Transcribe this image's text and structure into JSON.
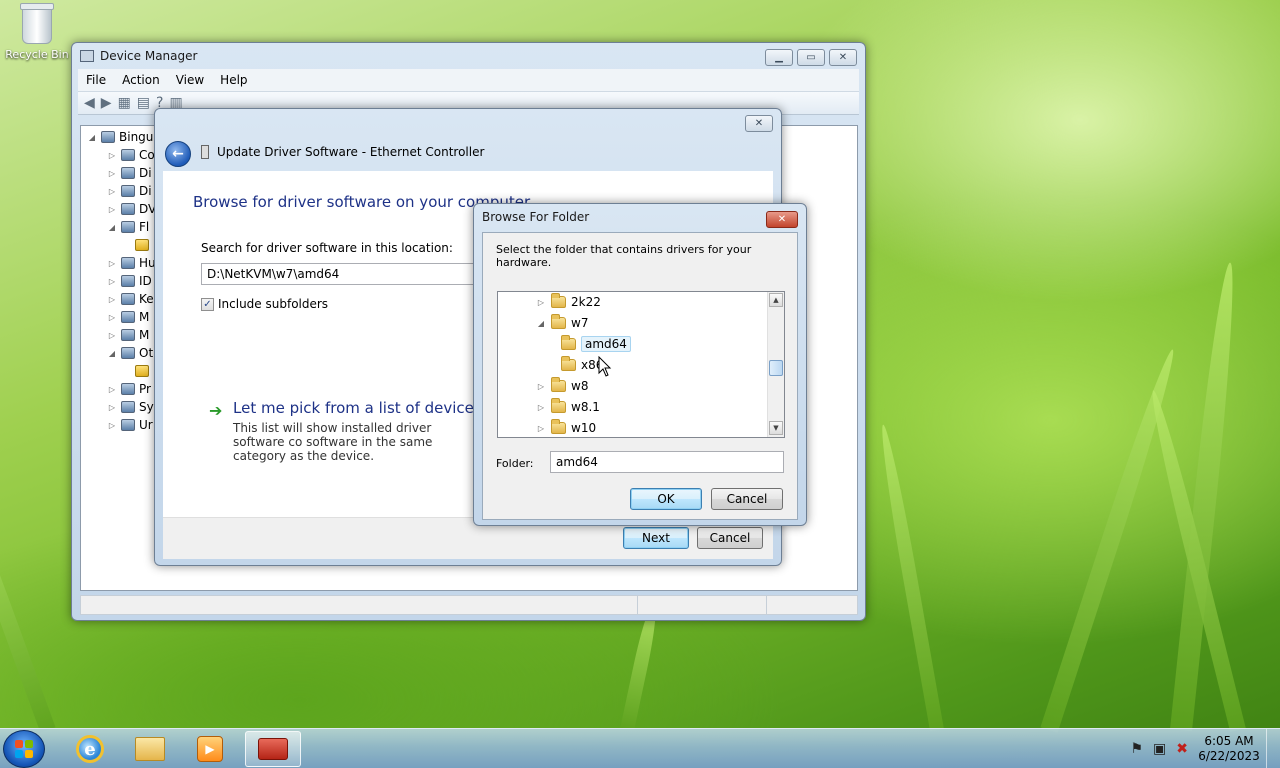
{
  "desktop": {
    "icons": [
      {
        "label": "Recycle Bin"
      }
    ]
  },
  "device_manager": {
    "title": "Device Manager",
    "menu": [
      "File",
      "Action",
      "View",
      "Help"
    ],
    "tree": {
      "root": "Bingu",
      "items": [
        "Co",
        "Di",
        "Di",
        "DV",
        "Fl",
        "",
        "Hu",
        "ID",
        "Ke",
        "M",
        "M",
        "Ot",
        "",
        "Pr",
        "Sy",
        "Ur"
      ]
    }
  },
  "update_driver": {
    "title": "Update Driver Software - Ethernet Controller",
    "heading": "Browse for driver software on your computer",
    "search_label": "Search for driver software in this location:",
    "path_value": "D:\\NetKVM\\w7\\amd64",
    "include_subfolders": {
      "label": "Include subfolders",
      "checked": true
    },
    "pick_title": "Let me pick from a list of device dri",
    "pick_desc": "This list will show installed driver software co software in the same category as the device.",
    "next_label": "Next",
    "cancel_label": "Cancel"
  },
  "browse_folder": {
    "title": "Browse For Folder",
    "description": "Select the folder that contains drivers for your hardware.",
    "tree": [
      {
        "label": "2k22",
        "level": 0,
        "expander": "collapsed"
      },
      {
        "label": "w7",
        "level": 0,
        "expander": "expanded"
      },
      {
        "label": "amd64",
        "level": 1,
        "expander": "none",
        "selected": true
      },
      {
        "label": "x86",
        "level": 1,
        "expander": "none"
      },
      {
        "label": "w8",
        "level": 0,
        "expander": "collapsed"
      },
      {
        "label": "w8.1",
        "level": 0,
        "expander": "collapsed"
      },
      {
        "label": "w10",
        "level": 0,
        "expander": "collapsed"
      }
    ],
    "folder_label": "Folder:",
    "folder_value": "amd64",
    "ok_label": "OK",
    "cancel_label": "Cancel"
  },
  "taskbar": {
    "clock_time": "6:05 AM",
    "clock_date": "6/22/2023"
  },
  "colors": {
    "link_blue": "#1e3287",
    "accent_green": "#2a9a2a"
  }
}
